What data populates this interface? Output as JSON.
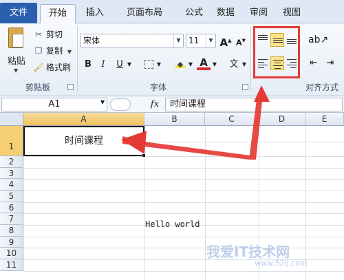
{
  "tabs": [
    {
      "label": "文件",
      "state": "file"
    },
    {
      "label": "开始",
      "state": "active"
    },
    {
      "label": "插入",
      "state": ""
    },
    {
      "label": "页面布局",
      "state": ""
    },
    {
      "label": "公式",
      "state": ""
    },
    {
      "label": "数据",
      "state": ""
    },
    {
      "label": "审阅",
      "state": ""
    },
    {
      "label": "视图",
      "state": ""
    }
  ],
  "clipboard": {
    "paste_label": "粘贴",
    "cut_label": "剪切",
    "copy_label": "复制",
    "format_painter_label": "格式刷",
    "group_label": "剪贴板"
  },
  "font": {
    "font_name": "宋体",
    "font_size": "11",
    "grow_label": "A",
    "shrink_label": "A",
    "bold_label": "B",
    "italic_label": "I",
    "underline_label": "U",
    "font_color_label": "A",
    "phonetic_label": "文",
    "group_label": "字体"
  },
  "alignment": {
    "group_label": "对齐方式",
    "selected_horizontal": "center",
    "selected_vertical": "middle"
  },
  "formula_bar": {
    "name_box": "A1",
    "fx_label": "fx",
    "content": "时间课程"
  },
  "sheet": {
    "columns": [
      "A",
      "B",
      "C",
      "D",
      "E"
    ],
    "rows": [
      "1",
      "2",
      "3",
      "4",
      "5",
      "6",
      "7",
      "8",
      "9",
      "10",
      "11"
    ],
    "cells": {
      "A1": "时间课程",
      "B7": "Hello world"
    }
  },
  "watermark": {
    "main": "我爱IT技术网",
    "sub": "www.52ij.com"
  },
  "colors": {
    "file_tab": "#2a5fb0",
    "highlight_box": "#e53935",
    "selected_button": "#fbe48a",
    "selected_header": "#f1c15f"
  }
}
